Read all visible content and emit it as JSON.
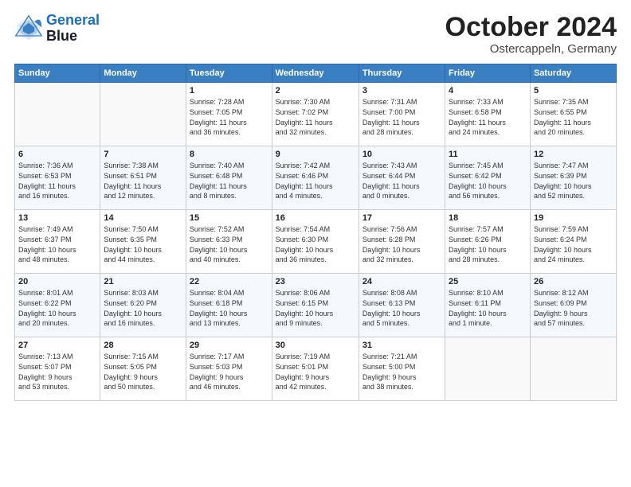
{
  "logo": {
    "line1": "General",
    "line2": "Blue"
  },
  "header": {
    "month": "October 2024",
    "location": "Ostercappeln, Germany"
  },
  "weekdays": [
    "Sunday",
    "Monday",
    "Tuesday",
    "Wednesday",
    "Thursday",
    "Friday",
    "Saturday"
  ],
  "weeks": [
    [
      {
        "day": "",
        "info": ""
      },
      {
        "day": "",
        "info": ""
      },
      {
        "day": "1",
        "info": "Sunrise: 7:28 AM\nSunset: 7:05 PM\nDaylight: 11 hours\nand 36 minutes."
      },
      {
        "day": "2",
        "info": "Sunrise: 7:30 AM\nSunset: 7:02 PM\nDaylight: 11 hours\nand 32 minutes."
      },
      {
        "day": "3",
        "info": "Sunrise: 7:31 AM\nSunset: 7:00 PM\nDaylight: 11 hours\nand 28 minutes."
      },
      {
        "day": "4",
        "info": "Sunrise: 7:33 AM\nSunset: 6:58 PM\nDaylight: 11 hours\nand 24 minutes."
      },
      {
        "day": "5",
        "info": "Sunrise: 7:35 AM\nSunset: 6:55 PM\nDaylight: 11 hours\nand 20 minutes."
      }
    ],
    [
      {
        "day": "6",
        "info": "Sunrise: 7:36 AM\nSunset: 6:53 PM\nDaylight: 11 hours\nand 16 minutes."
      },
      {
        "day": "7",
        "info": "Sunrise: 7:38 AM\nSunset: 6:51 PM\nDaylight: 11 hours\nand 12 minutes."
      },
      {
        "day": "8",
        "info": "Sunrise: 7:40 AM\nSunset: 6:48 PM\nDaylight: 11 hours\nand 8 minutes."
      },
      {
        "day": "9",
        "info": "Sunrise: 7:42 AM\nSunset: 6:46 PM\nDaylight: 11 hours\nand 4 minutes."
      },
      {
        "day": "10",
        "info": "Sunrise: 7:43 AM\nSunset: 6:44 PM\nDaylight: 11 hours\nand 0 minutes."
      },
      {
        "day": "11",
        "info": "Sunrise: 7:45 AM\nSunset: 6:42 PM\nDaylight: 10 hours\nand 56 minutes."
      },
      {
        "day": "12",
        "info": "Sunrise: 7:47 AM\nSunset: 6:39 PM\nDaylight: 10 hours\nand 52 minutes."
      }
    ],
    [
      {
        "day": "13",
        "info": "Sunrise: 7:49 AM\nSunset: 6:37 PM\nDaylight: 10 hours\nand 48 minutes."
      },
      {
        "day": "14",
        "info": "Sunrise: 7:50 AM\nSunset: 6:35 PM\nDaylight: 10 hours\nand 44 minutes."
      },
      {
        "day": "15",
        "info": "Sunrise: 7:52 AM\nSunset: 6:33 PM\nDaylight: 10 hours\nand 40 minutes."
      },
      {
        "day": "16",
        "info": "Sunrise: 7:54 AM\nSunset: 6:30 PM\nDaylight: 10 hours\nand 36 minutes."
      },
      {
        "day": "17",
        "info": "Sunrise: 7:56 AM\nSunset: 6:28 PM\nDaylight: 10 hours\nand 32 minutes."
      },
      {
        "day": "18",
        "info": "Sunrise: 7:57 AM\nSunset: 6:26 PM\nDaylight: 10 hours\nand 28 minutes."
      },
      {
        "day": "19",
        "info": "Sunrise: 7:59 AM\nSunset: 6:24 PM\nDaylight: 10 hours\nand 24 minutes."
      }
    ],
    [
      {
        "day": "20",
        "info": "Sunrise: 8:01 AM\nSunset: 6:22 PM\nDaylight: 10 hours\nand 20 minutes."
      },
      {
        "day": "21",
        "info": "Sunrise: 8:03 AM\nSunset: 6:20 PM\nDaylight: 10 hours\nand 16 minutes."
      },
      {
        "day": "22",
        "info": "Sunrise: 8:04 AM\nSunset: 6:18 PM\nDaylight: 10 hours\nand 13 minutes."
      },
      {
        "day": "23",
        "info": "Sunrise: 8:06 AM\nSunset: 6:15 PM\nDaylight: 10 hours\nand 9 minutes."
      },
      {
        "day": "24",
        "info": "Sunrise: 8:08 AM\nSunset: 6:13 PM\nDaylight: 10 hours\nand 5 minutes."
      },
      {
        "day": "25",
        "info": "Sunrise: 8:10 AM\nSunset: 6:11 PM\nDaylight: 10 hours\nand 1 minute."
      },
      {
        "day": "26",
        "info": "Sunrise: 8:12 AM\nSunset: 6:09 PM\nDaylight: 9 hours\nand 57 minutes."
      }
    ],
    [
      {
        "day": "27",
        "info": "Sunrise: 7:13 AM\nSunset: 5:07 PM\nDaylight: 9 hours\nand 53 minutes."
      },
      {
        "day": "28",
        "info": "Sunrise: 7:15 AM\nSunset: 5:05 PM\nDaylight: 9 hours\nand 50 minutes."
      },
      {
        "day": "29",
        "info": "Sunrise: 7:17 AM\nSunset: 5:03 PM\nDaylight: 9 hours\nand 46 minutes."
      },
      {
        "day": "30",
        "info": "Sunrise: 7:19 AM\nSunset: 5:01 PM\nDaylight: 9 hours\nand 42 minutes."
      },
      {
        "day": "31",
        "info": "Sunrise: 7:21 AM\nSunset: 5:00 PM\nDaylight: 9 hours\nand 38 minutes."
      },
      {
        "day": "",
        "info": ""
      },
      {
        "day": "",
        "info": ""
      }
    ]
  ]
}
